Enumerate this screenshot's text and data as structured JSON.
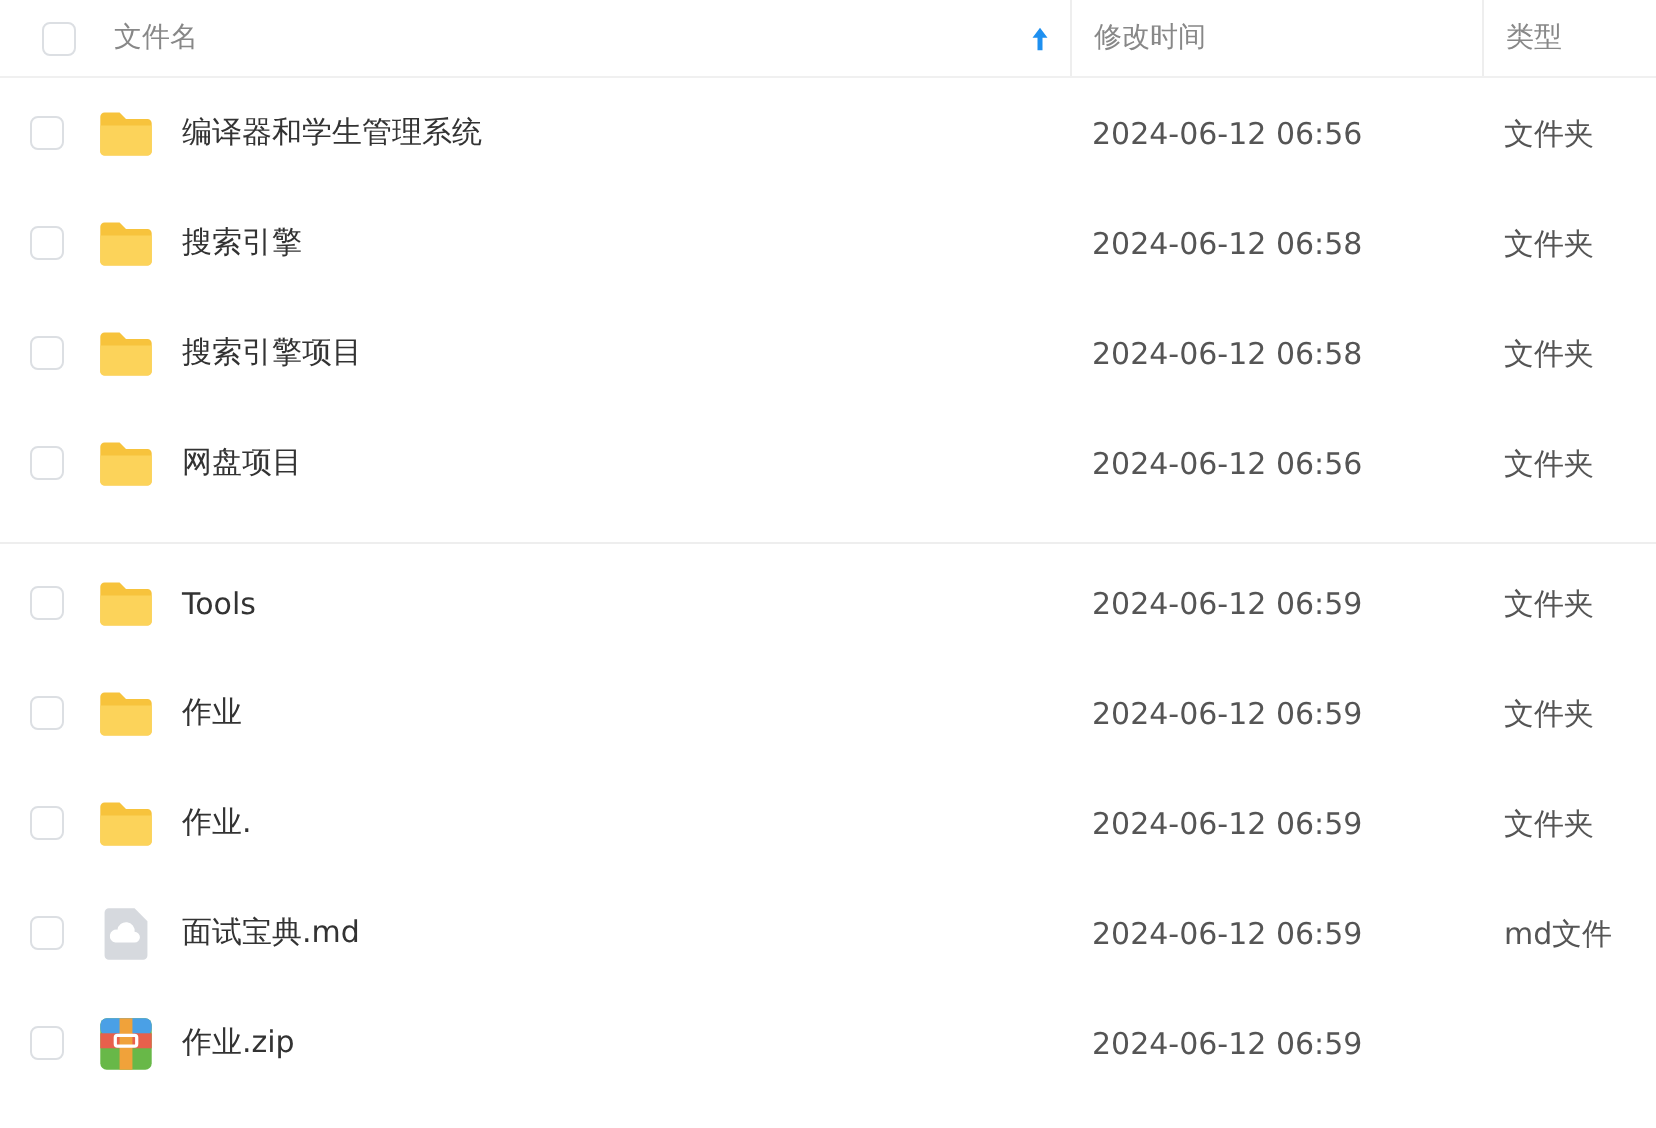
{
  "table": {
    "columns": [
      {
        "label": "文件名",
        "sorted": true
      },
      {
        "label": "修改时间"
      },
      {
        "label": "类型"
      }
    ],
    "header_checkbox": {
      "checked": false
    },
    "sections": [
      {
        "rows": [
          {
            "kind": "folder",
            "name": "编译器和学生管理系统",
            "modified": "2024-06-12 06:56",
            "type": "文件夹",
            "checked": false
          },
          {
            "kind": "folder",
            "name": "搜索引擎",
            "modified": "2024-06-12 06:58",
            "type": "文件夹",
            "checked": false
          },
          {
            "kind": "folder",
            "name": "搜索引擎项目",
            "modified": "2024-06-12 06:58",
            "type": "文件夹",
            "checked": false
          },
          {
            "kind": "folder",
            "name": "网盘项目",
            "modified": "2024-06-12 06:56",
            "type": "文件夹",
            "checked": false
          }
        ]
      },
      {
        "rows": [
          {
            "kind": "folder",
            "name": "Tools",
            "modified": "2024-06-12 06:59",
            "type": "文件夹",
            "checked": false
          },
          {
            "kind": "folder",
            "name": "作业",
            "modified": "2024-06-12 06:59",
            "type": "文件夹",
            "checked": false
          },
          {
            "kind": "folder",
            "name": "作业.",
            "modified": "2024-06-12 06:59",
            "type": "文件夹",
            "checked": false
          },
          {
            "kind": "doc",
            "name": "面试宝典.md",
            "modified": "2024-06-12 06:59",
            "type": "md文件",
            "checked": false
          },
          {
            "kind": "zip",
            "name": "作业.zip",
            "modified": "2024-06-12 06:59",
            "checked": false
          }
        ]
      }
    ]
  }
}
